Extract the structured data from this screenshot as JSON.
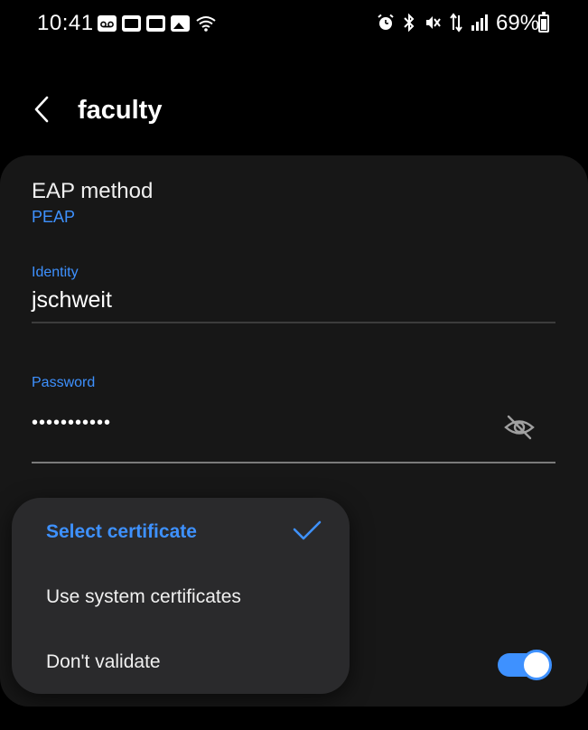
{
  "status_bar": {
    "time": "10:41",
    "battery_percent": "69%",
    "left_icons": [
      "voicemail-icon",
      "sim-icon",
      "sim-icon",
      "gallery-icon",
      "wifi-icon"
    ],
    "right_icons": [
      "alarm-icon",
      "bluetooth-icon",
      "mute-icon",
      "data-icon",
      "signal-icon"
    ]
  },
  "header": {
    "title": "faculty",
    "back_icon": "back-chevron-icon"
  },
  "form": {
    "eap_method_label": "EAP method",
    "eap_method_value": "PEAP",
    "identity_label": "Identity",
    "identity_value": "jschweit",
    "password_label": "Password",
    "password_value": "•••••••••••",
    "toggle_state": "on"
  },
  "dropdown": {
    "selected_index": 0,
    "items": [
      {
        "label": "Select certificate"
      },
      {
        "label": "Use system certificates"
      },
      {
        "label": "Don't validate"
      }
    ]
  },
  "colors": {
    "accent": "#3e91ff",
    "card_bg": "#171717",
    "popup_bg": "#2a2a2c",
    "background": "#000000"
  }
}
